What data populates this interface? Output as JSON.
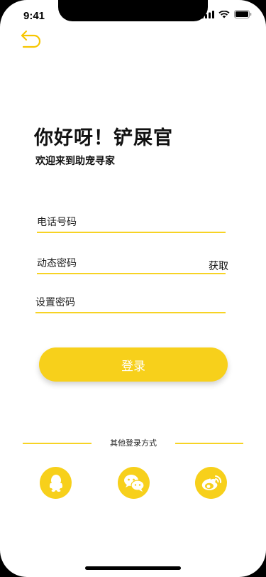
{
  "status_bar": {
    "time": "9:41"
  },
  "header": {
    "greeting": "你好呀！铲屎官",
    "subtitle": "欢迎来到助宠寻家"
  },
  "form": {
    "phone_placeholder": "电话号码",
    "code_placeholder": "动态密码",
    "get_code_label": "获取",
    "password_placeholder": "设置密码",
    "login_label": "登录"
  },
  "other_login": {
    "label": "其他登录方式",
    "providers": [
      "qq-icon",
      "wechat-icon",
      "weibo-icon"
    ]
  },
  "colors": {
    "accent": "#f7d01b",
    "underline": "#f7d324"
  }
}
